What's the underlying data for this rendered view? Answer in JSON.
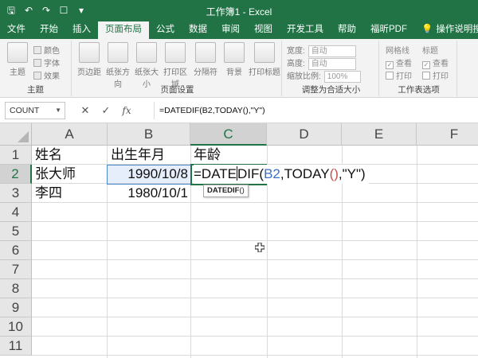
{
  "window": {
    "title": "工作簿1 - Excel"
  },
  "quick_access": {
    "save_icon": "save-icon",
    "undo_icon": "undo-icon",
    "redo_icon": "redo-icon",
    "touch_icon": "touch-mode-icon",
    "customize_icon": "customize-icon"
  },
  "ribbon_tabs": [
    "文件",
    "开始",
    "插入",
    "页面布局",
    "公式",
    "数据",
    "审阅",
    "视图",
    "开发工具",
    "帮助",
    "福昕PDF",
    "操作说明搜索"
  ],
  "active_tab": "页面布局",
  "ribbon": {
    "theme_group": {
      "label": "主题",
      "button": "主题",
      "colors": "颜色",
      "fonts": "字体",
      "effects": "效果"
    },
    "page_setup_group": {
      "label": "页面设置",
      "buttons": [
        "页边距",
        "纸张方向",
        "纸张大小",
        "打印区域",
        "分隔符",
        "背景",
        "打印标题"
      ]
    },
    "scale_group": {
      "label": "调整为合适大小",
      "width_label": "宽度:",
      "width_value": "自动",
      "height_label": "高度:",
      "height_value": "自动",
      "scale_label": "缩放比例:",
      "scale_value": "100%"
    },
    "sheet_options_group": {
      "label": "工作表选项",
      "gridlines": "网格线",
      "headings": "标题",
      "view": "查看",
      "print": "打印"
    }
  },
  "formula_bar": {
    "name_box": "COUNT",
    "cancel": "✕",
    "enter": "✓",
    "fx": "fx",
    "formula": "=DATEDIF(B2,TODAY(),\"Y\")"
  },
  "columns": [
    "A",
    "B",
    "C",
    "D",
    "E",
    "F"
  ],
  "rows": [
    "1",
    "2",
    "3",
    "4",
    "5",
    "6",
    "7",
    "8",
    "9",
    "10",
    "11"
  ],
  "cells": {
    "A1": "姓名",
    "B1": "出生年月",
    "C1": "年龄",
    "A2": "张大师",
    "B2": "1990/10/8",
    "A3": "李四",
    "B3": "1980/10/1"
  },
  "editing": {
    "prefix": "=DATE",
    "mid": "DIF(",
    "ref": "B2",
    "comma1": ",TODAY",
    "paren": "()",
    "tail": ",\"Y\")"
  },
  "tooltip": {
    "func": "DATEDIF",
    "rest": "()"
  },
  "colors": {
    "excel_green": "#217346",
    "ref_blue": "#3a6fc4",
    "paren_red": "#c0504d"
  }
}
